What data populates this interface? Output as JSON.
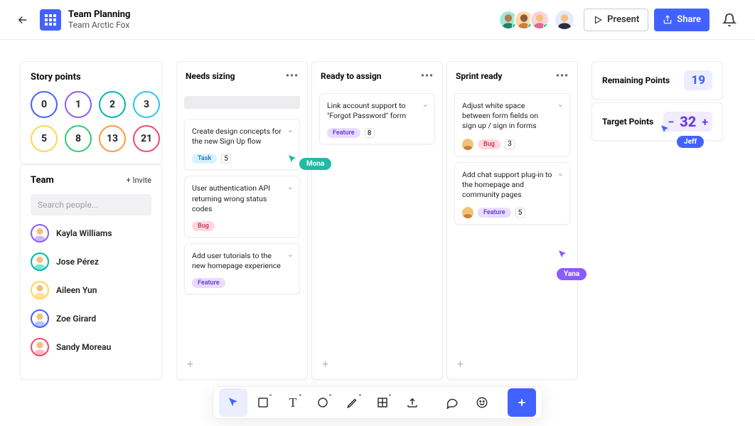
{
  "header": {
    "title": "Team Planning",
    "subtitle": "Team Arctic Fox",
    "present_label": "Present",
    "share_label": "Share"
  },
  "story_points": {
    "title": "Story points",
    "chips": [
      {
        "value": "0",
        "ring": "blue"
      },
      {
        "value": "1",
        "ring": "purple"
      },
      {
        "value": "2",
        "ring": "teal"
      },
      {
        "value": "3",
        "ring": "cyan"
      },
      {
        "value": "5",
        "ring": "yellow"
      },
      {
        "value": "8",
        "ring": "green"
      },
      {
        "value": "13",
        "ring": "orange"
      },
      {
        "value": "21",
        "ring": "red"
      }
    ]
  },
  "team": {
    "title": "Team",
    "invite_label": "+ Invite",
    "search_placeholder": "Search people...",
    "members": [
      {
        "name": "Kayla Williams",
        "ring": "purple"
      },
      {
        "name": "Jose Pérez",
        "ring": "teal"
      },
      {
        "name": "Aileen Yun",
        "ring": "yellow"
      },
      {
        "name": "Zoe Girard",
        "ring": "blue"
      },
      {
        "name": "Sandy Moreau",
        "ring": "red"
      }
    ]
  },
  "columns": [
    {
      "title": "Needs sizing",
      "show_placeholder": true,
      "cards": [
        {
          "title": "Create design concepts for the new Sign Up flow",
          "tag": "Task",
          "tag_class": "task",
          "points": "5",
          "avatar": false
        },
        {
          "title": "User authentication API returning wrong status codes",
          "tag": "Bug",
          "tag_class": "bug",
          "points": null,
          "avatar": false
        },
        {
          "title": "Add user tutorials to the new homepage experience",
          "tag": "Feature",
          "tag_class": "feature",
          "points": null,
          "avatar": false
        }
      ]
    },
    {
      "title": "Ready to assign",
      "show_placeholder": false,
      "cards": [
        {
          "title": "Link account support to \"Forgot Password\" form",
          "tag": "Feature",
          "tag_class": "feature",
          "points": "8",
          "avatar": false
        }
      ]
    },
    {
      "title": "Sprint ready",
      "show_placeholder": false,
      "cards": [
        {
          "title": "Adjust white space between form fields on sign up / sign in forms",
          "tag": "Bug",
          "tag_class": "bug",
          "points": "3",
          "avatar": true
        },
        {
          "title": "Add chat support plug-in to the homepage and community pages",
          "tag": "Feature",
          "tag_class": "feature",
          "points": "5",
          "avatar": true
        }
      ]
    }
  ],
  "remaining": {
    "label": "Remaining Points",
    "value": "19"
  },
  "target": {
    "label": "Target Points",
    "value": "32"
  },
  "collaborators": {
    "mona": "Mona",
    "yana": "Yana",
    "jeff": "Jeff"
  },
  "add_plus": "+"
}
